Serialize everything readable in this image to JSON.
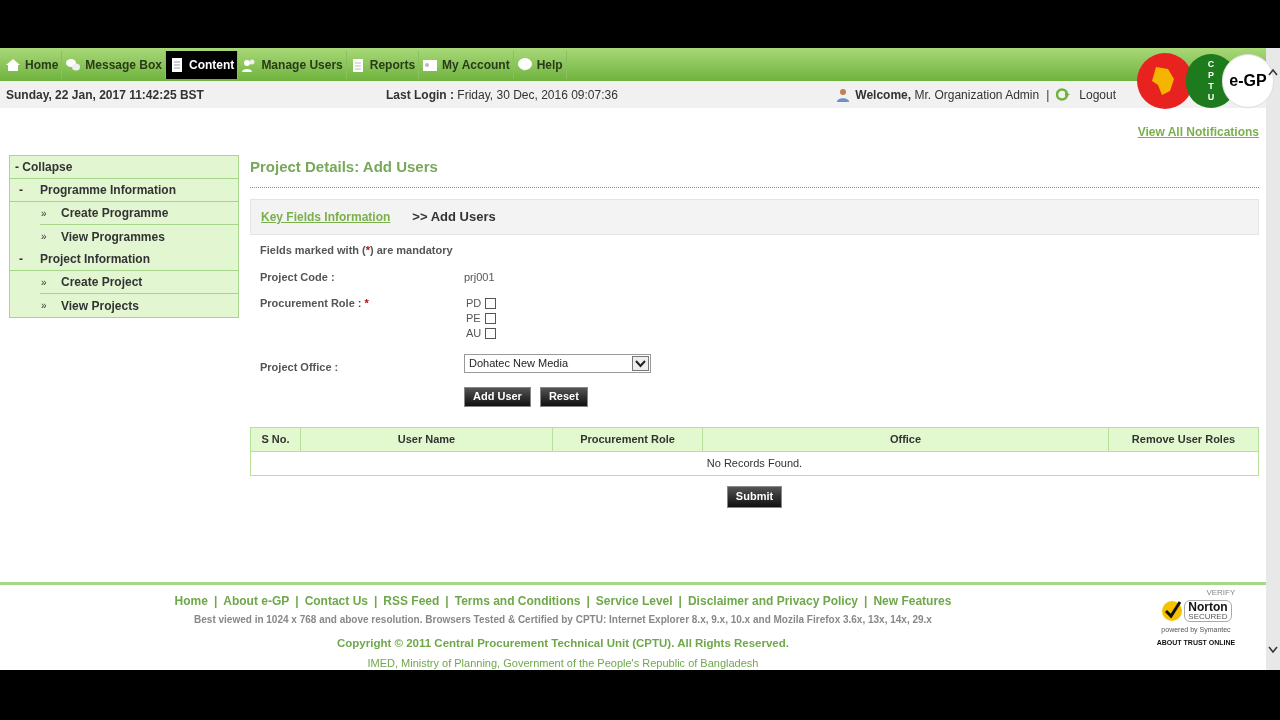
{
  "nav": [
    {
      "label": "Home",
      "selected": false
    },
    {
      "label": "Message Box",
      "selected": false
    },
    {
      "label": "Content",
      "selected": true
    },
    {
      "label": "Manage Users",
      "selected": false
    },
    {
      "label": "Reports",
      "selected": false
    },
    {
      "label": "My Account",
      "selected": false
    },
    {
      "label": "Help",
      "selected": false
    }
  ],
  "logo": {
    "letters": [
      "C",
      "P",
      "T",
      "U"
    ],
    "text": "e-GP"
  },
  "info_bar": {
    "date": "Sunday, 22 Jan, 2017 11:42:25 BST",
    "last_login_label": "Last Login :",
    "last_login": "Friday, 30 Dec, 2016 09:07:36",
    "welcome": "Welcome,",
    "user": "Mr. Organization Admin",
    "separator": "|",
    "logout": "Logout"
  },
  "notifications_link": "View All Notifications",
  "sidebar": {
    "collapse": "- Collapse",
    "sections": [
      {
        "marker": "-",
        "title": "Programme Information",
        "children": [
          {
            "marker": "»",
            "label": "Create Programme"
          },
          {
            "marker": "»",
            "label": "View Programmes"
          }
        ]
      },
      {
        "marker": "-",
        "title": "Project Information",
        "children": [
          {
            "marker": "»",
            "label": "Create Project"
          },
          {
            "marker": "»",
            "label": "View Projects"
          }
        ]
      }
    ]
  },
  "page_title": "Project Details: Add Users",
  "breadcrumb": {
    "link": "Key Fields Information",
    "separator": ">>",
    "current": "Add Users"
  },
  "form": {
    "note_before": "Fields marked with (",
    "note_star": "*",
    "note_after": ") are mandatory",
    "project_code_label": "Project Code :",
    "project_code": "prj001",
    "role_label": "Procurement Role :",
    "role_required": "*",
    "roles": [
      {
        "label": "PD",
        "checked": false
      },
      {
        "label": "PE",
        "checked": false
      },
      {
        "label": "AU",
        "checked": false
      }
    ],
    "office_label": "Project Office :",
    "office": "Dohatec New Media",
    "buttons": [
      "Add User",
      "Reset"
    ]
  },
  "table": {
    "columns": [
      "S No.",
      "User Name",
      "Procurement Role",
      "Office",
      "Remove User Roles"
    ],
    "empty": "No Records Found."
  },
  "submit": "Submit",
  "footer": {
    "links": [
      "Home",
      "About e-GP",
      "Contact Us",
      "RSS Feed",
      "Terms and Conditions",
      "Service Level",
      "Disclaimer and Privacy Policy",
      "New Features"
    ],
    "separator": "|",
    "browsers": "Best viewed in 1024 x 768 and above resolution. Browsers Tested & Certified by CPTU: Internet Explorer 8.x, 9.x, 10.x and Mozila Firefox 3.6x, 13x, 14x, 29.x",
    "copyright": "Copyright © 2011 Central Procurement Technical Unit (CPTU). All Rights Reserved.",
    "ministry": "IMED, Ministry of Planning, Government of the People's Republic of Bangladesh",
    "badge": {
      "top": "VERIFY",
      "name": "Norton",
      "secured": "SECURED",
      "powered": "powered by Symantec",
      "about": "ABOUT TRUST ONLINE"
    }
  }
}
